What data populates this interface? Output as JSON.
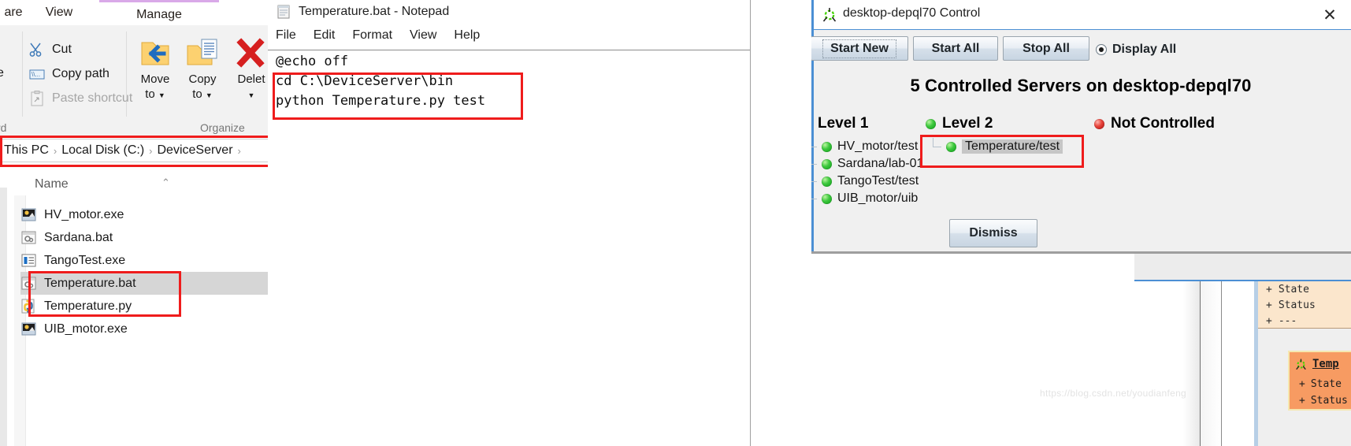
{
  "explorer": {
    "tabs": [
      {
        "label": "are",
        "active": false
      },
      {
        "label": "View",
        "active": false
      },
      {
        "label": "Manage",
        "active": true
      }
    ],
    "clipboard_group_label": "rd",
    "organize_group_label": "Organize",
    "paste_partial_label": "e",
    "commands": [
      {
        "label": "Cut",
        "icon": "scissors-icon",
        "dim": false
      },
      {
        "label": "Copy path",
        "icon": "copy-path-icon",
        "dim": false
      },
      {
        "label": "Paste shortcut",
        "icon": "paste-shortcut-icon",
        "dim": true
      }
    ],
    "big_commands": [
      {
        "label1": "Move",
        "label2": "to",
        "icon": "move-to-icon"
      },
      {
        "label1": "Copy",
        "label2": "to",
        "icon": "copy-to-icon"
      },
      {
        "label1": "Delet",
        "label2": "",
        "icon": "delete-icon"
      }
    ],
    "breadcrumb": [
      "This PC",
      "Local Disk (C:)",
      "DeviceServer"
    ],
    "breadcrumb_separator": "›",
    "column_header": "Name",
    "files": [
      {
        "name": "HV_motor.exe",
        "icon": "exe-app-icon",
        "selected": false
      },
      {
        "name": "Sardana.bat",
        "icon": "bat-file-icon",
        "selected": false
      },
      {
        "name": "TangoTest.exe",
        "icon": "exe-generic-icon",
        "selected": false
      },
      {
        "name": "Temperature.bat",
        "icon": "bat-file-icon",
        "selected": true
      },
      {
        "name": "Temperature.py",
        "icon": "python-file-icon",
        "selected": false
      },
      {
        "name": "UIB_motor.exe",
        "icon": "exe-app-icon",
        "selected": false
      }
    ]
  },
  "notepad": {
    "title": "Temperature.bat - Notepad",
    "icon": "notepad-icon",
    "menu": [
      "File",
      "Edit",
      "Format",
      "View",
      "Help"
    ],
    "content": "@echo off\ncd C:\\DeviceServer\\bin\npython Temperature.py test"
  },
  "control": {
    "title": "desktop-depql70  Control",
    "icon": "tango-logo-icon",
    "close_label": "✕",
    "buttons": [
      {
        "label": "Start New",
        "focused": true
      },
      {
        "label": "Start All",
        "focused": false
      },
      {
        "label": "Stop All",
        "focused": false
      }
    ],
    "radio": {
      "label": "Display All",
      "checked": true
    },
    "heading": "5 Controlled Servers on desktop-depql70",
    "columns": [
      {
        "title": "Level 1",
        "status": "green",
        "items": [
          {
            "name": "HV_motor/test",
            "status": "green",
            "selected": false
          },
          {
            "name": "Sardana/lab-01",
            "status": "green",
            "selected": false
          },
          {
            "name": "TangoTest/test",
            "status": "green",
            "selected": false
          },
          {
            "name": "UIB_motor/uib",
            "status": "green",
            "selected": false
          }
        ]
      },
      {
        "title": "Level 2",
        "status": "green",
        "items": [
          {
            "name": "Temperature/test",
            "status": "green",
            "selected": true
          }
        ]
      },
      {
        "title": "Not Controlled",
        "status": "red",
        "items": []
      }
    ],
    "dismiss_label": "Dismiss"
  },
  "astor": {
    "attr_list": [
      {
        "prefix": "+",
        "label": "State"
      },
      {
        "prefix": "+",
        "label": "Status"
      },
      {
        "prefix": "+",
        "label": "---"
      }
    ],
    "card": {
      "title": "Temp",
      "icon": "tango-logo-icon",
      "items": [
        {
          "prefix": "+",
          "label": "State"
        },
        {
          "prefix": "+",
          "label": "Status"
        }
      ]
    }
  },
  "watermark": "https://blog.csdn.net/youdianfeng"
}
